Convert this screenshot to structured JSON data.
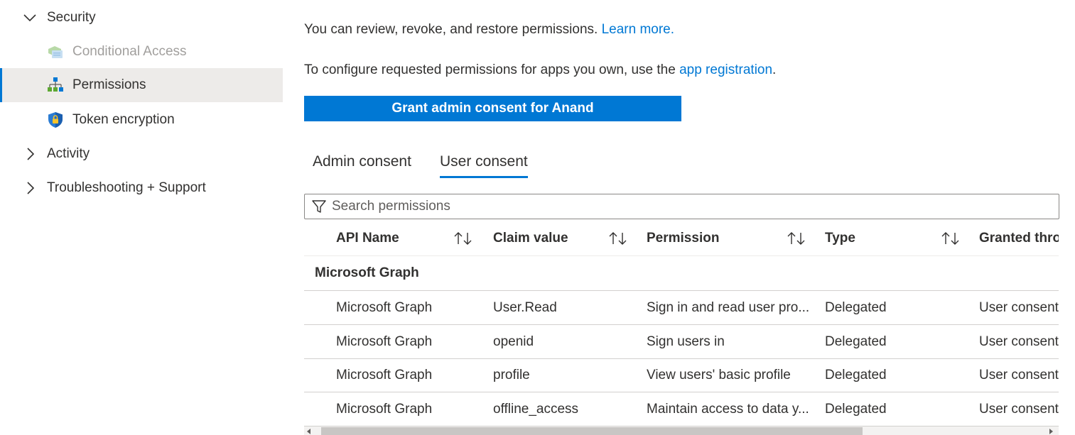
{
  "sidebar": {
    "items": [
      {
        "label": "Security",
        "icon": "chevron-down-icon",
        "expanded": true
      },
      {
        "label": "Conditional Access",
        "icon": "conditional-access-icon",
        "disabled": true
      },
      {
        "label": "Permissions",
        "icon": "permissions-icon",
        "selected": true
      },
      {
        "label": "Token encryption",
        "icon": "shield-lock-icon"
      },
      {
        "label": "Activity",
        "icon": "chevron-right-icon",
        "expanded": false
      },
      {
        "label": "Troubleshooting + Support",
        "icon": "chevron-right-icon",
        "expanded": false
      }
    ]
  },
  "main": {
    "intro": {
      "text": "You can review, revoke, and restore permissions. ",
      "link": "Learn more."
    },
    "configure": {
      "text": "To configure requested permissions for apps you own, use the ",
      "link": "app registration",
      "suffix": "."
    },
    "grant_button": "Grant admin consent for Anand",
    "tabs": [
      {
        "label": "Admin consent",
        "active": false
      },
      {
        "label": "User consent",
        "active": true
      }
    ],
    "search": {
      "placeholder": "Search permissions",
      "value": ""
    },
    "table": {
      "columns": [
        "API Name",
        "Claim value",
        "Permission",
        "Type",
        "Granted thro"
      ],
      "group": "Microsoft Graph",
      "rows": [
        {
          "api": "Microsoft Graph",
          "claim": "User.Read",
          "permission": "Sign in and read user pro...",
          "type": "Delegated",
          "granted": "User consent"
        },
        {
          "api": "Microsoft Graph",
          "claim": "openid",
          "permission": "Sign users in",
          "type": "Delegated",
          "granted": "User consent"
        },
        {
          "api": "Microsoft Graph",
          "claim": "profile",
          "permission": "View users' basic profile",
          "type": "Delegated",
          "granted": "User consent"
        },
        {
          "api": "Microsoft Graph",
          "claim": "offline_access",
          "permission": "Maintain access to data y...",
          "type": "Delegated",
          "granted": "User consent"
        }
      ]
    }
  },
  "colors": {
    "accent": "#0078d4",
    "selected_bg": "#edebe9",
    "text": "#323130",
    "disabled_text": "#a19f9d"
  }
}
